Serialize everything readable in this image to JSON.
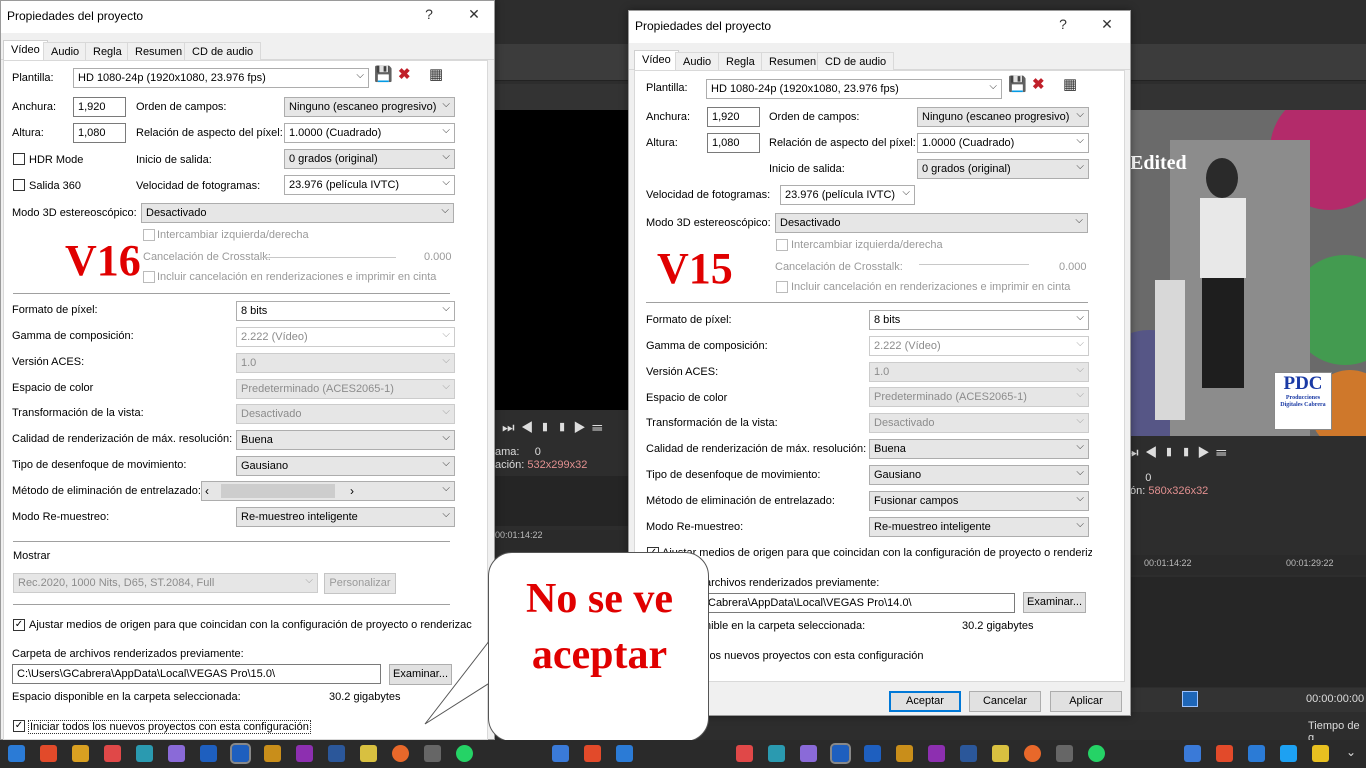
{
  "background": {
    "edited_text": "Edited",
    "logo_text": "PDC",
    "logo_sub": "Producciones Digitales Cabrera",
    "left_frame": "ama:",
    "left_frame_val": "0",
    "left_res_label": "ación:",
    "left_res": "532x299x32",
    "right_frame": "",
    "right_frame_val": "0",
    "right_res_label": "ón:",
    "right_res": "580x326x32",
    "left_timecode": "00:01:14:22",
    "right_timecode_1": "00:01:14:22",
    "right_timecode_2": "00:01:29:22",
    "clock": "00:00:00:00",
    "tiempo": "Tiempo de g"
  },
  "v16": {
    "title": "Propiedades del proyecto",
    "help": "?",
    "close": "✕",
    "tabs": [
      "Vídeo",
      "Audio",
      "Regla",
      "Resumen",
      "CD de audio"
    ],
    "plantilla_label": "Plantilla:",
    "plantilla_value": "HD 1080-24p (1920x1080, 23.976 fps)",
    "anchura_label": "Anchura:",
    "anchura_value": "1,920",
    "altura_label": "Altura:",
    "altura_value": "1,080",
    "orden_label": "Orden de campos:",
    "orden_value": "Ninguno (escaneo progresivo)",
    "relacion_label": "Relación de aspecto del píxel:",
    "relacion_value": "1.0000 (Cuadrado)",
    "hdr_label": "HDR Mode",
    "inicio_label": "Inicio de salida:",
    "inicio_value": "0 grados (original)",
    "salida360_label": "Salida 360",
    "velocidad_label": "Velocidad de fotogramas:",
    "velocidad_value": "23.976 (película IVTC)",
    "modo3d_label": "Modo 3D estereoscópico:",
    "modo3d_value": "Desactivado",
    "intercambiar_label": "Intercambiar izquierda/derecha",
    "crosstalk_label": "Cancelación de Crosstalk:",
    "crosstalk_value": "0.000",
    "incluir_label": "Incluir cancelación en renderizaciones e imprimir en cinta",
    "formato_label": "Formato de píxel:",
    "formato_value": "8 bits",
    "gamma_label": "Gamma de composición:",
    "gamma_value": "2.222 (Vídeo)",
    "aces_label": "Versión ACES:",
    "aces_value": "1.0",
    "espacio_label": "Espacio de color",
    "espacio_value": "Predeterminado (ACES2065-1)",
    "transformacion_label": "Transformación de la vista:",
    "transformacion_value": "Desactivado",
    "calidad_label": "Calidad de renderización de máx. resolución:",
    "calidad_value": "Buena",
    "desenfoque_label": "Tipo de desenfoque de movimiento:",
    "desenfoque_value": "Gausiano",
    "entrelazado_label": "Método de eliminación de entrelazado:",
    "remuestreo_label": "Modo Re-muestreo:",
    "remuestreo_value": "Re-muestreo inteligente",
    "mostrar_label": "Mostrar",
    "mostrar_value": "Rec.2020, 1000 Nits, D65, ST.2084, Full",
    "personalizar_label": "Personalizar",
    "ajustar_label": "Ajustar medios de origen para que coincidan con la configuración de proyecto o renderizac",
    "carpeta_label": "Carpeta de archivos renderizados previamente:",
    "carpeta_value": "C:\\Users\\GCabrera\\AppData\\Local\\VEGAS Pro\\15.0\\",
    "examinar_label": "Examinar...",
    "disponible_label": "Espacio disponible en la carpeta seleccionada:",
    "disponible_value": "30.2 gigabytes",
    "iniciar_label": "Iniciar todos los nuevos proyectos con esta configuración",
    "version_tag": "V16"
  },
  "v15": {
    "title": "Propiedades del proyecto",
    "help": "?",
    "close": "✕",
    "tabs": [
      "Vídeo",
      "Audio",
      "Regla",
      "Resumen",
      "CD de audio"
    ],
    "plantilla_label": "Plantilla:",
    "plantilla_value": "HD 1080-24p (1920x1080, 23.976 fps)",
    "anchura_label": "Anchura:",
    "anchura_value": "1,920",
    "altura_label": "Altura:",
    "altura_value": "1,080",
    "orden_label": "Orden de campos:",
    "orden_value": "Ninguno (escaneo progresivo)",
    "relacion_label": "Relación de aspecto del píxel:",
    "relacion_value": "1.0000 (Cuadrado)",
    "inicio_label": "Inicio de salida:",
    "inicio_value": "0 grados (original)",
    "velocidad_label": "Velocidad de fotogramas:",
    "velocidad_value": "23.976 (película IVTC)",
    "modo3d_label": "Modo 3D estereoscópico:",
    "modo3d_value": "Desactivado",
    "intercambiar_label": "Intercambiar izquierda/derecha",
    "crosstalk_label": "Cancelación de Crosstalk:",
    "crosstalk_value": "0.000",
    "incluir_label": "Incluir cancelación en renderizaciones e imprimir en cinta",
    "formato_label": "Formato de píxel:",
    "formato_value": "8 bits",
    "gamma_label": "Gamma de composición:",
    "gamma_value": "2.222 (Vídeo)",
    "aces_label": "Versión ACES:",
    "aces_value": "1.0",
    "espacio_label": "Espacio de color",
    "espacio_value": "Predeterminado (ACES2065-1)",
    "transformacion_label": "Transformación de la vista:",
    "transformacion_value": "Desactivado",
    "calidad_label": "Calidad de renderización de máx. resolución:",
    "calidad_value": "Buena",
    "desenfoque_label": "Tipo de desenfoque de movimiento:",
    "desenfoque_value": "Gausiano",
    "entrelazado_label": "Método de eliminación de entrelazado:",
    "entrelazado_value": "Fusionar campos",
    "remuestreo_label": "Modo Re-muestreo:",
    "remuestreo_value": "Re-muestreo inteligente",
    "ajustar_label": "Ajustar medios de origen para que coincidan con la configuración de proyecto o renderizac",
    "carpeta_label": "archivos renderizados previamente:",
    "carpeta_value": "Cabrera\\AppData\\Local\\VEGAS Pro\\14.0\\",
    "examinar_label": "Examinar...",
    "disponible_label": "nible en la carpeta seleccionada:",
    "disponible_value": "30.2 gigabytes",
    "iniciar_label": "los nuevos proyectos con esta configuración",
    "aceptar_label": "Aceptar",
    "cancelar_label": "Cancelar",
    "aplicar_label": "Aplicar",
    "version_tag": "V15"
  },
  "callout": {
    "line1": "No se ve",
    "line2": "aceptar"
  },
  "colors": {
    "accent": "#0078d7",
    "annotation_red": "#e00000"
  }
}
